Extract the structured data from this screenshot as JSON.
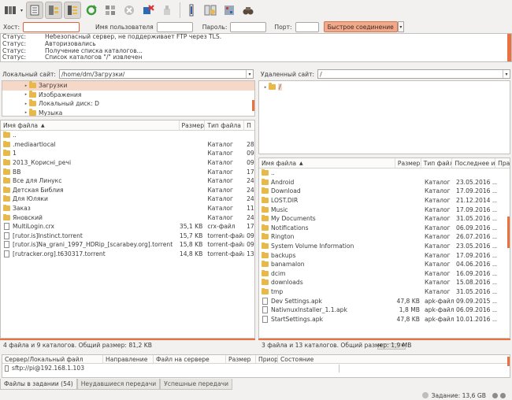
{
  "toolbar": {
    "buttons": [
      "site-manager-icon",
      "toggle-log-icon",
      "toggle-local-tree-icon",
      "toggle-remote-tree-icon",
      "refresh-icon",
      "process-queue-icon",
      "cancel-icon",
      "disconnect-icon",
      "reconnect-icon",
      "filter-icon",
      "compare-icon",
      "search-icon"
    ]
  },
  "quickconnect": {
    "host_label": "Хост:",
    "user_label": "Имя пользователя",
    "pass_label": "Пароль:",
    "port_label": "Порт:",
    "button_label": "Быстрое соединение",
    "host_value": "",
    "user_value": "",
    "pass_value": "",
    "port_value": ""
  },
  "log": [
    {
      "k": "Статус:",
      "v": "Небезопасный сервер, не поддерживает FTP через TLS."
    },
    {
      "k": "Статус:",
      "v": "Авторизовались"
    },
    {
      "k": "Статус:",
      "v": "Получение списка каталогов..."
    },
    {
      "k": "Статус:",
      "v": "Список каталогов \"/\" извлечен"
    }
  ],
  "local": {
    "label": "Локальный сайт:",
    "path": "/home/dm/Загрузки/",
    "tree": [
      "Загрузки",
      "Изображения",
      "Локальный диск: D",
      "Музыка"
    ],
    "headers": {
      "name": "Имя файла",
      "size": "Размер",
      "type": "Тип файла",
      "mod": "П"
    },
    "files": [
      {
        "name": "..",
        "size": "",
        "type": "",
        "mod": "",
        "kind": "folder"
      },
      {
        "name": ".mediaartlocal",
        "size": "",
        "type": "Каталог",
        "mod": "28.",
        "kind": "folder"
      },
      {
        "name": "1",
        "size": "",
        "type": "Каталог",
        "mod": "09.",
        "kind": "folder"
      },
      {
        "name": "2013_Корисні_речі",
        "size": "",
        "type": "Каталог",
        "mod": "09.",
        "kind": "folder"
      },
      {
        "name": "BB",
        "size": "",
        "type": "Каталог",
        "mod": "17.",
        "kind": "folder"
      },
      {
        "name": "Все для Линукс",
        "size": "",
        "type": "Каталог",
        "mod": "24.",
        "kind": "folder"
      },
      {
        "name": "Детская Библия",
        "size": "",
        "type": "Каталог",
        "mod": "24.",
        "kind": "folder"
      },
      {
        "name": "Для Юляки",
        "size": "",
        "type": "Каталог",
        "mod": "24.",
        "kind": "folder"
      },
      {
        "name": "Заказ",
        "size": "",
        "type": "Каталог",
        "mod": "11.",
        "kind": "folder"
      },
      {
        "name": "Яновский",
        "size": "",
        "type": "Каталог",
        "mod": "24.",
        "kind": "folder"
      },
      {
        "name": "MultiLogin.crx",
        "size": "35,1 KB",
        "type": "crx-файл",
        "mod": "17.",
        "kind": "file"
      },
      {
        "name": "[rutor.is]Instinct.torrent",
        "size": "15,7 KB",
        "type": "torrent-файл",
        "mod": "09.",
        "kind": "file"
      },
      {
        "name": "[rutor.is]Na_grani_1997_HDRip_[scarabey.org].torrent",
        "size": "15,8 KB",
        "type": "torrent-файл",
        "mod": "09.",
        "kind": "file"
      },
      {
        "name": "[rutracker.org].t630317.torrent",
        "size": "14,8 KB",
        "type": "torrent-файл",
        "mod": "13.",
        "kind": "file"
      }
    ],
    "status": "4 файла и 9 каталогов. Общий размер: 81,2 KB"
  },
  "remote": {
    "label": "Удаленный сайт:",
    "path": "/",
    "tree": [
      "/"
    ],
    "headers": {
      "name": "Имя файла",
      "size": "Размер",
      "type": "Тип файла",
      "mod": "Последнее из",
      "perm": "Права"
    },
    "files": [
      {
        "name": "..",
        "size": "",
        "type": "",
        "mod": "",
        "kind": "folder"
      },
      {
        "name": "Android",
        "size": "",
        "type": "Каталог",
        "mod": "23.05.2016 ...",
        "kind": "folder"
      },
      {
        "name": "Download",
        "size": "",
        "type": "Каталог",
        "mod": "17.09.2016 ...",
        "kind": "folder"
      },
      {
        "name": "LOST.DIR",
        "size": "",
        "type": "Каталог",
        "mod": "21.12.2014 ...",
        "kind": "folder"
      },
      {
        "name": "Music",
        "size": "",
        "type": "Каталог",
        "mod": "17.09.2016 ...",
        "kind": "folder"
      },
      {
        "name": "My Documents",
        "size": "",
        "type": "Каталог",
        "mod": "31.05.2016 ...",
        "kind": "folder"
      },
      {
        "name": "Notifications",
        "size": "",
        "type": "Каталог",
        "mod": "06.09.2016 ...",
        "kind": "folder"
      },
      {
        "name": "Rington",
        "size": "",
        "type": "Каталог",
        "mod": "26.07.2016 ...",
        "kind": "folder"
      },
      {
        "name": "System Volume Information",
        "size": "",
        "type": "Каталог",
        "mod": "23.05.2016 ...",
        "kind": "folder"
      },
      {
        "name": "backups",
        "size": "",
        "type": "Каталог",
        "mod": "17.09.2016 ...",
        "kind": "folder"
      },
      {
        "name": "banamalon",
        "size": "",
        "type": "Каталог",
        "mod": "04.06.2016 ...",
        "kind": "folder"
      },
      {
        "name": "dcim",
        "size": "",
        "type": "Каталог",
        "mod": "16.09.2016 ...",
        "kind": "folder"
      },
      {
        "name": "downloads",
        "size": "",
        "type": "Каталог",
        "mod": "15.08.2016 ...",
        "kind": "folder"
      },
      {
        "name": "tmp",
        "size": "",
        "type": "Каталог",
        "mod": "31.05.2016 ...",
        "kind": "folder"
      },
      {
        "name": "Dev Settings.apk",
        "size": "47,8 KB",
        "type": "apk-файл",
        "mod": "09.09.2015 ...",
        "kind": "file"
      },
      {
        "name": "NativnuxInstaller_1.1.apk",
        "size": "1,8 MB",
        "type": "apk-файл",
        "mod": "06.09.2016 ...",
        "kind": "file"
      },
      {
        "name": "StartSettings.apk",
        "size": "47,8 KB",
        "type": "apk-файл",
        "mod": "10.01.2016 ...",
        "kind": "file"
      }
    ],
    "status": "3 файла и 13 каталогов. Общий размер: 1,9 MB"
  },
  "queue": {
    "headers": {
      "server": "Сервер/Локальный файл",
      "dir": "Направление",
      "remote": "Файл на сервере",
      "size": "Размер",
      "prio": "Приори",
      "state": "Состояние"
    },
    "server": "sftp://pi@192.168.1.103"
  },
  "tabs": [
    "Файлы в задании (54)",
    "Неудавшиеся передачи",
    "Успешные передачи"
  ],
  "statusbar": {
    "queue": "Задание: 13,6 GB"
  },
  "colors": {
    "accent": "#e97240",
    "folder": "#e9b84a"
  }
}
